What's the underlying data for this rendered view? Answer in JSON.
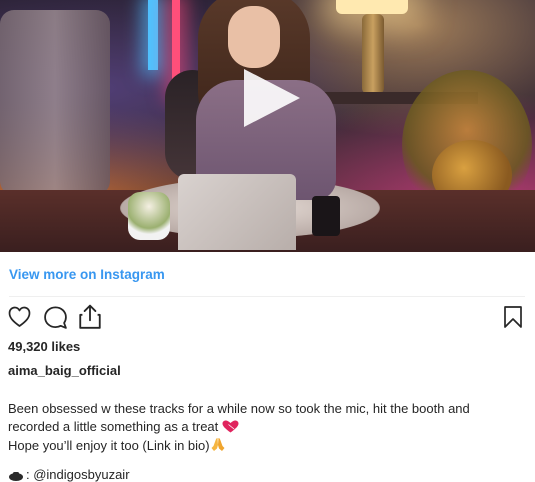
{
  "post": {
    "view_more_link": "View more on Instagram",
    "likes": "49,320 likes",
    "username": "aima_baig_official",
    "caption_line1": "Been obsessed w these tracks for a while now so took the mic, hit the booth and",
    "caption_line2": "recorded a little something as a treat",
    "caption_line3": "Hope you’ll enjoy it too (Link in bio)",
    "mention": ": @indigosbyuzair"
  },
  "icons": {
    "play": "play-icon",
    "like": "heart-outline-icon",
    "comment": "comment-bubble-icon",
    "share": "share-upload-icon",
    "save": "bookmark-icon",
    "caption_emoji_1": "red-heart-emoji-icon",
    "caption_emoji_2": "folded-hands-emoji-icon",
    "mention_emoji": "tuxedo-emoji-icon"
  },
  "colors": {
    "link": "#3897f0",
    "text": "#262626",
    "divider": "#efefef",
    "heart_emoji": "#e0245e"
  }
}
